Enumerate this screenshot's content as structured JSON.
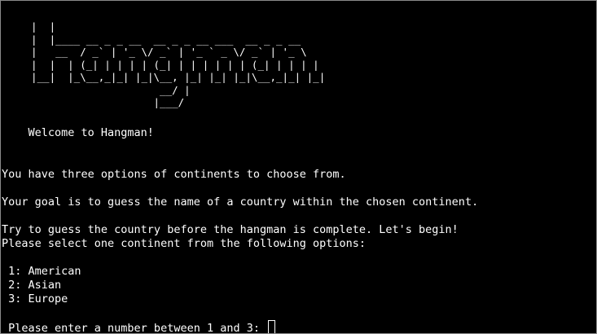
{
  "banner_art": [
    "|  |",
    "|  |____ __ _ _ __  __ _ _ __ ___  __ _ _ __",
    "|   __  / _` | '_ \\/ _` | '_ ` _ \\/ _` | '_ \\",
    "|  |  | (_| | | | | (_| | | | | | | (_| | | | |",
    "|__|  |_\\__,_|_| |_|\\__, |_| |_| |_|\\__,_|_| |_|",
    "                     __/ |",
    "                    |___/"
  ],
  "welcome": "    Welcome to Hangman!",
  "intro_options": "You have three options of continents to choose from.",
  "intro_goal": "Your goal is to guess the name of a country within the chosen continent.",
  "intro_begin": "Try to guess the country before the hangman is complete. Let's begin!",
  "select_prompt": "Please select one continent from the following options:",
  "options": [
    " 1: American",
    " 2: Asian",
    " 3: Europe"
  ],
  "input_prompt": " Please enter a number between 1 and 3: "
}
